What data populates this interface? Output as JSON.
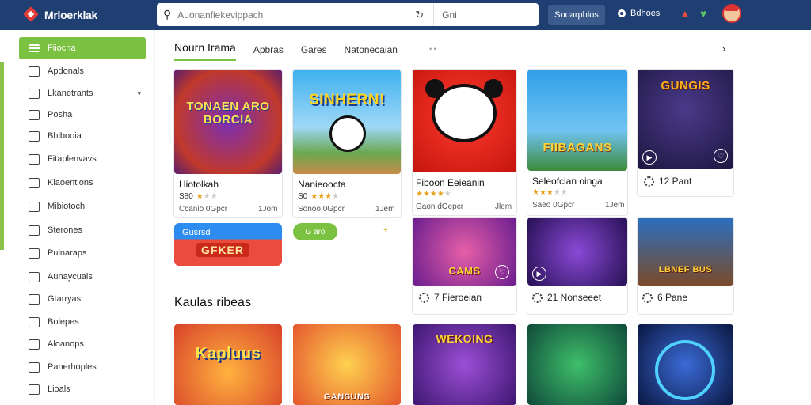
{
  "topbar": {
    "logo_text": "Mrloerklak",
    "search_placeholder": "Auonanfiekevippach",
    "search_extra": "Gni",
    "button_label": "Sooarpblos",
    "link_label": "Bdhoes"
  },
  "sidebar": {
    "items": [
      {
        "label": "Fiiocna",
        "active": true
      },
      {
        "label": "Apdonals"
      },
      {
        "label": "Lkanetrants",
        "chevron": true
      },
      {
        "label": "Posha"
      },
      {
        "label": "Bhibooia"
      },
      {
        "label": "Fitaplenvavs"
      },
      {
        "label": "Klaoentions"
      },
      {
        "label": "Mibiotoch"
      },
      {
        "label": "Sterones"
      },
      {
        "label": "Pulnaraps"
      },
      {
        "label": "Aunaycuals"
      },
      {
        "label": "Gtarryas"
      },
      {
        "label": "Bolepes"
      },
      {
        "label": "Aloanops"
      },
      {
        "label": "Panerhoples"
      },
      {
        "label": "Lioals"
      }
    ]
  },
  "main": {
    "tabs": [
      "Nourn Irama",
      "Apbras",
      "Gares",
      "Natonecaian"
    ],
    "tab_dots": "• •",
    "section2_title": "Kaulas ribeas",
    "promo": {
      "top": "Gusrsd",
      "bottom": "GFKER"
    },
    "pill_label": "G aro",
    "pill_extra": "+",
    "cards_row1": [
      {
        "art": "TONAEN ARO BORCIA",
        "title": "Hiotolkah",
        "rating_label": "S80",
        "stars": 1,
        "meta": "Ccanio 0Gpcr",
        "size": "1Jom"
      },
      {
        "art": "SINHERN!",
        "title": "Nanieoocta",
        "rating_label": "S0",
        "stars": 3,
        "meta": "Sonoo 0Gpcr",
        "size": "1Jem"
      },
      {
        "title": "Fiboon Eeieanin",
        "stars": 4,
        "meta": "Gaon dOepcr",
        "size": "Jlem"
      },
      {
        "art": "FIIBAGANS",
        "title": "Seleofcian oinga",
        "stars": 3,
        "meta": "Saeo 0Gpcr",
        "size": "1Jem"
      },
      {
        "art": "GUNGIS",
        "foot": "12 Pant"
      }
    ],
    "cards_row2": [
      {
        "art": "CAMS",
        "foot": "7 Fieroeian"
      },
      {
        "foot": "21 Nonseeet"
      },
      {
        "art": "LBNEF BUS",
        "foot": "6 Pane"
      }
    ],
    "cards_row3": [
      {
        "art": "Kapluus"
      },
      {
        "art": "GANSUNS"
      },
      {
        "art": "WEKOING"
      },
      {
        "art": ""
      },
      {
        "art": ""
      }
    ]
  },
  "colors": {
    "topbar": "#1f3f73",
    "accent_green": "#7cc242",
    "sidebar_accent": "#8bc34a",
    "star": "#e6a11a"
  }
}
